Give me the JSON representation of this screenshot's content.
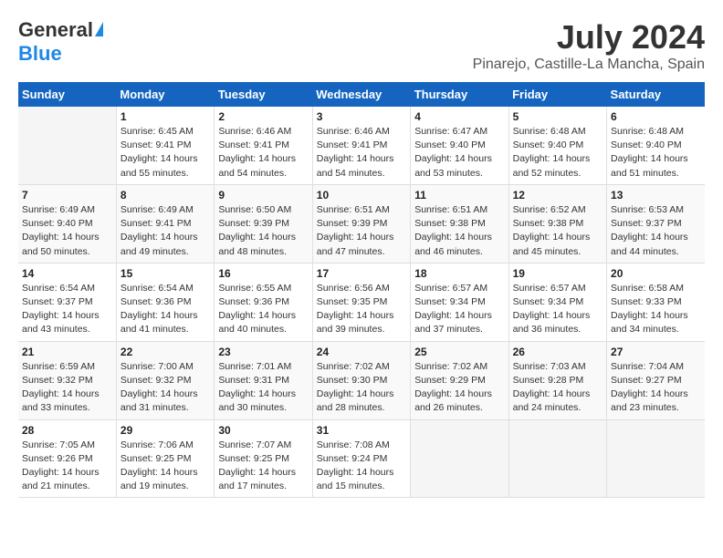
{
  "header": {
    "logo_general": "General",
    "logo_blue": "Blue",
    "month_year": "July 2024",
    "location": "Pinarejo, Castille-La Mancha, Spain"
  },
  "weekdays": [
    "Sunday",
    "Monday",
    "Tuesday",
    "Wednesday",
    "Thursday",
    "Friday",
    "Saturday"
  ],
  "weeks": [
    [
      {
        "day": "",
        "sunrise": "",
        "sunset": "",
        "daylight": ""
      },
      {
        "day": "1",
        "sunrise": "Sunrise: 6:45 AM",
        "sunset": "Sunset: 9:41 PM",
        "daylight": "Daylight: 14 hours and 55 minutes."
      },
      {
        "day": "2",
        "sunrise": "Sunrise: 6:46 AM",
        "sunset": "Sunset: 9:41 PM",
        "daylight": "Daylight: 14 hours and 54 minutes."
      },
      {
        "day": "3",
        "sunrise": "Sunrise: 6:46 AM",
        "sunset": "Sunset: 9:41 PM",
        "daylight": "Daylight: 14 hours and 54 minutes."
      },
      {
        "day": "4",
        "sunrise": "Sunrise: 6:47 AM",
        "sunset": "Sunset: 9:40 PM",
        "daylight": "Daylight: 14 hours and 53 minutes."
      },
      {
        "day": "5",
        "sunrise": "Sunrise: 6:48 AM",
        "sunset": "Sunset: 9:40 PM",
        "daylight": "Daylight: 14 hours and 52 minutes."
      },
      {
        "day": "6",
        "sunrise": "Sunrise: 6:48 AM",
        "sunset": "Sunset: 9:40 PM",
        "daylight": "Daylight: 14 hours and 51 minutes."
      }
    ],
    [
      {
        "day": "7",
        "sunrise": "Sunrise: 6:49 AM",
        "sunset": "Sunset: 9:40 PM",
        "daylight": "Daylight: 14 hours and 50 minutes."
      },
      {
        "day": "8",
        "sunrise": "Sunrise: 6:49 AM",
        "sunset": "Sunset: 9:41 PM",
        "daylight": "Daylight: 14 hours and 49 minutes."
      },
      {
        "day": "9",
        "sunrise": "Sunrise: 6:50 AM",
        "sunset": "Sunset: 9:39 PM",
        "daylight": "Daylight: 14 hours and 48 minutes."
      },
      {
        "day": "10",
        "sunrise": "Sunrise: 6:51 AM",
        "sunset": "Sunset: 9:39 PM",
        "daylight": "Daylight: 14 hours and 47 minutes."
      },
      {
        "day": "11",
        "sunrise": "Sunrise: 6:51 AM",
        "sunset": "Sunset: 9:38 PM",
        "daylight": "Daylight: 14 hours and 46 minutes."
      },
      {
        "day": "12",
        "sunrise": "Sunrise: 6:52 AM",
        "sunset": "Sunset: 9:38 PM",
        "daylight": "Daylight: 14 hours and 45 minutes."
      },
      {
        "day": "13",
        "sunrise": "Sunrise: 6:53 AM",
        "sunset": "Sunset: 9:37 PM",
        "daylight": "Daylight: 14 hours and 44 minutes."
      }
    ],
    [
      {
        "day": "14",
        "sunrise": "Sunrise: 6:54 AM",
        "sunset": "Sunset: 9:37 PM",
        "daylight": "Daylight: 14 hours and 43 minutes."
      },
      {
        "day": "15",
        "sunrise": "Sunrise: 6:54 AM",
        "sunset": "Sunset: 9:36 PM",
        "daylight": "Daylight: 14 hours and 41 minutes."
      },
      {
        "day": "16",
        "sunrise": "Sunrise: 6:55 AM",
        "sunset": "Sunset: 9:36 PM",
        "daylight": "Daylight: 14 hours and 40 minutes."
      },
      {
        "day": "17",
        "sunrise": "Sunrise: 6:56 AM",
        "sunset": "Sunset: 9:35 PM",
        "daylight": "Daylight: 14 hours and 39 minutes."
      },
      {
        "day": "18",
        "sunrise": "Sunrise: 6:57 AM",
        "sunset": "Sunset: 9:34 PM",
        "daylight": "Daylight: 14 hours and 37 minutes."
      },
      {
        "day": "19",
        "sunrise": "Sunrise: 6:57 AM",
        "sunset": "Sunset: 9:34 PM",
        "daylight": "Daylight: 14 hours and 36 minutes."
      },
      {
        "day": "20",
        "sunrise": "Sunrise: 6:58 AM",
        "sunset": "Sunset: 9:33 PM",
        "daylight": "Daylight: 14 hours and 34 minutes."
      }
    ],
    [
      {
        "day": "21",
        "sunrise": "Sunrise: 6:59 AM",
        "sunset": "Sunset: 9:32 PM",
        "daylight": "Daylight: 14 hours and 33 minutes."
      },
      {
        "day": "22",
        "sunrise": "Sunrise: 7:00 AM",
        "sunset": "Sunset: 9:32 PM",
        "daylight": "Daylight: 14 hours and 31 minutes."
      },
      {
        "day": "23",
        "sunrise": "Sunrise: 7:01 AM",
        "sunset": "Sunset: 9:31 PM",
        "daylight": "Daylight: 14 hours and 30 minutes."
      },
      {
        "day": "24",
        "sunrise": "Sunrise: 7:02 AM",
        "sunset": "Sunset: 9:30 PM",
        "daylight": "Daylight: 14 hours and 28 minutes."
      },
      {
        "day": "25",
        "sunrise": "Sunrise: 7:02 AM",
        "sunset": "Sunset: 9:29 PM",
        "daylight": "Daylight: 14 hours and 26 minutes."
      },
      {
        "day": "26",
        "sunrise": "Sunrise: 7:03 AM",
        "sunset": "Sunset: 9:28 PM",
        "daylight": "Daylight: 14 hours and 24 minutes."
      },
      {
        "day": "27",
        "sunrise": "Sunrise: 7:04 AM",
        "sunset": "Sunset: 9:27 PM",
        "daylight": "Daylight: 14 hours and 23 minutes."
      }
    ],
    [
      {
        "day": "28",
        "sunrise": "Sunrise: 7:05 AM",
        "sunset": "Sunset: 9:26 PM",
        "daylight": "Daylight: 14 hours and 21 minutes."
      },
      {
        "day": "29",
        "sunrise": "Sunrise: 7:06 AM",
        "sunset": "Sunset: 9:25 PM",
        "daylight": "Daylight: 14 hours and 19 minutes."
      },
      {
        "day": "30",
        "sunrise": "Sunrise: 7:07 AM",
        "sunset": "Sunset: 9:25 PM",
        "daylight": "Daylight: 14 hours and 17 minutes."
      },
      {
        "day": "31",
        "sunrise": "Sunrise: 7:08 AM",
        "sunset": "Sunset: 9:24 PM",
        "daylight": "Daylight: 14 hours and 15 minutes."
      },
      {
        "day": "",
        "sunrise": "",
        "sunset": "",
        "daylight": ""
      },
      {
        "day": "",
        "sunrise": "",
        "sunset": "",
        "daylight": ""
      },
      {
        "day": "",
        "sunrise": "",
        "sunset": "",
        "daylight": ""
      }
    ]
  ]
}
